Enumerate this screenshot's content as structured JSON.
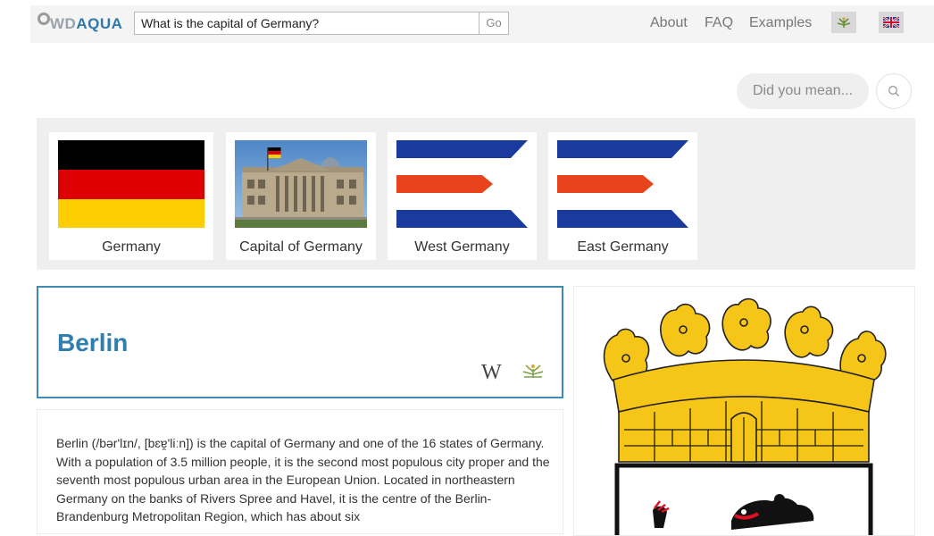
{
  "header": {
    "logo_prefix": "WD",
    "logo_suffix": "AQUA",
    "search_value": "What is the capital of Germany?",
    "go_label": "Go",
    "nav": {
      "about": "About",
      "faq": "FAQ",
      "examples": "Examples"
    },
    "language_icons": [
      "wikidata-language-icon",
      "uk-flag-icon"
    ]
  },
  "did_you_mean": {
    "label": "Did you mean...",
    "icon": "search-icon"
  },
  "entities": [
    {
      "label": "Germany",
      "image": "germany-flag"
    },
    {
      "label": "Capital of Germany",
      "image": "reichstag-photo"
    },
    {
      "label": "West Germany",
      "image": "west-germany-flag"
    },
    {
      "label": "East Germany",
      "image": "east-germany-flag"
    }
  ],
  "answer": {
    "title": "Berlin",
    "wiki_glyph": "W",
    "abstract": "Berlin (/bər'lɪn/, [bɛɐ̯'liːn]) is the capital of Germany and one of the 16 states of Germany. With a population of 3.5 million people, it is the second most populous city proper and the seventh most populous urban area in the European Union. Located in northeastern Germany on the banks of Rivers Spree and Havel, it is the centre of the Berlin-Brandenburg Metropolitan Region, which has about six"
  },
  "image_panel": {
    "image": "berlin-coat-of-arms"
  },
  "colors": {
    "accent": "#3e8bb3",
    "title": "#2f7eb0",
    "flag_black": "#000000",
    "flag_red": "#dd0000",
    "flag_gold": "#ffce00",
    "ensign_blue": "#1a3a9e",
    "ensign_red": "#e8431c",
    "crown_gold": "#f5c518"
  }
}
